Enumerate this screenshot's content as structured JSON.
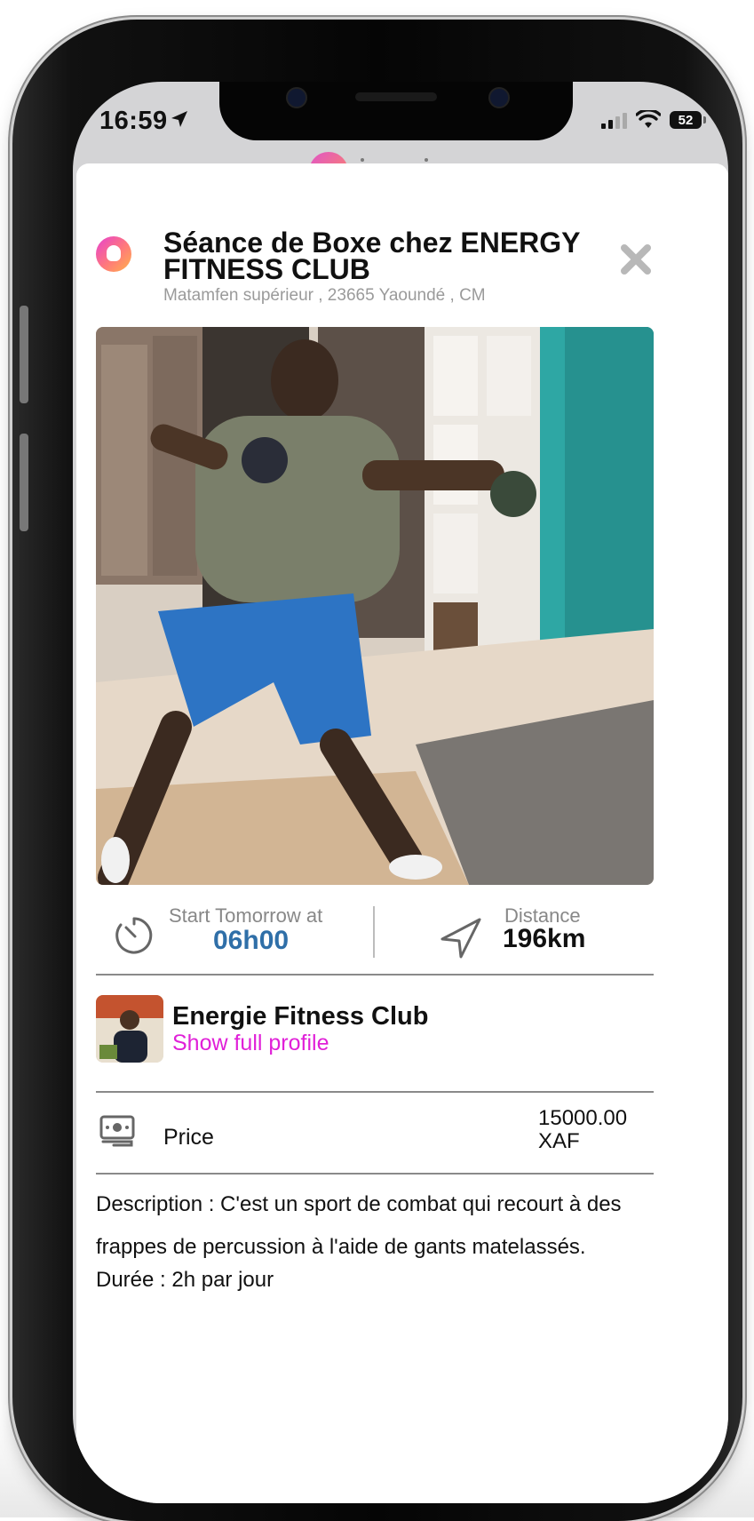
{
  "status_bar": {
    "time": "16:59",
    "battery": "52"
  },
  "event": {
    "title": "Séance  de Boxe chez ENERGY FITNESS CLUB",
    "address": "Matamfen supérieur , 23665 Yaoundé , CM"
  },
  "schedule": {
    "start_label": "Start Tomorrow at",
    "start_time": "06h00",
    "distance_label": "Distance",
    "distance_value": "196km"
  },
  "organizer": {
    "name": "Energie Fitness Club",
    "profile_link": "Show full profile"
  },
  "price": {
    "label": "Price",
    "amount": "15000.00",
    "currency": "XAF"
  },
  "description": {
    "text": "Description : C'est un sport de combat qui recourt à des frappes de percussion à l'aide de gants matelassés.",
    "duration": "Durée : 2h par jour"
  },
  "colors": {
    "link": "#e020d8",
    "time_accent": "#2f6fa8"
  },
  "icons": {
    "close": "close-icon",
    "timer": "timer-icon",
    "navigation": "navigation-arrow-icon",
    "cash": "cash-icon"
  }
}
